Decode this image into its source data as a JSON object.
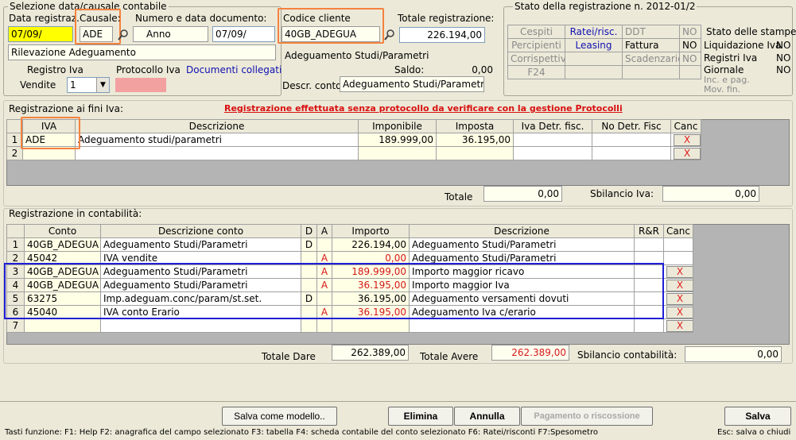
{
  "selection": {
    "legend": "Selezione data/causale contabile",
    "date_label": "Data registraz.",
    "date_value": "07/09/",
    "causale_label": "Causale:",
    "causale_value": "ADE",
    "num_label": "Numero e data documento:",
    "anno_value": "Anno",
    "doc_date_value": "07/09/",
    "codice_label": "Codice cliente",
    "codice_value": "40GB_ADEGUA",
    "totale_label": "Totale registrazione:",
    "totale_value": "226.194,00",
    "rilevazione_value": "Rilevazione Adeguamento",
    "cliente_name": "Adeguamento Studi/Parametri",
    "registro_label": "Registro Iva",
    "protocollo_label": "Protocollo Iva",
    "documenti_link": "Documenti collegati",
    "vendite_label": "Vendite",
    "vendite_value": "1",
    "saldo_label": "Saldo:",
    "saldo_value": "0,00",
    "descr_conto_label": "Descr. conto",
    "descr_conto_value": "Adeguamento Studi/Parametri"
  },
  "stato": {
    "legend": "Stato della registrazione n. 2012-01/2",
    "rows": [
      {
        "a": "Cespiti",
        "b": "Ratei/risc.",
        "c": "DDT",
        "d": "NO"
      },
      {
        "a": "Percipienti",
        "b": "Leasing",
        "c": "Fattura",
        "d": "NO"
      },
      {
        "a": "Corrispettivi",
        "b": "",
        "c": "Scadenzario",
        "d": "NO"
      },
      {
        "a": "F24",
        "b": "",
        "c": "",
        "d": ""
      }
    ],
    "stampe_title": "Stato delle stampe:",
    "stampe": [
      {
        "label": "Liquidazione Iva",
        "value": "NO"
      },
      {
        "label": "Registri Iva",
        "value": "NO"
      },
      {
        "label": "Giornale",
        "value": "NO"
      },
      {
        "label": "Inc. e pag.",
        "value": ""
      },
      {
        "label": "Mov. fin.",
        "value": ""
      }
    ]
  },
  "iva": {
    "title": "Registrazione ai fini Iva:",
    "warning": "Registrazione effettuata senza protocollo da verificare con la gestione Protocolli",
    "headers": [
      "IVA",
      "Descrizione",
      "Imponibile",
      "Imposta",
      "Iva Detr. fisc.",
      "No Detr. Fisc",
      "Canc"
    ],
    "rows": [
      {
        "n": "1",
        "iva": "ADE",
        "descr": "Adeguamento studi/parametri",
        "imponibile": "189.999,00",
        "imposta": "36.195,00",
        "detr": "",
        "nodetr": "",
        "canc": "X"
      },
      {
        "n": "2",
        "iva": "",
        "descr": "",
        "imponibile": "",
        "imposta": "",
        "detr": "",
        "nodetr": "",
        "canc": "X"
      }
    ],
    "totale_label": "Totale",
    "totale_value": "0,00",
    "sbilancio_label": "Sbilancio Iva:",
    "sbilancio_value": "0,00"
  },
  "contab": {
    "title": "Registrazione in contabilità:",
    "headers": [
      "Conto",
      "Descrizione conto",
      "D",
      "A",
      "Importo",
      "Descrizione",
      "R&R",
      "Canc"
    ],
    "rows": [
      {
        "n": "1",
        "conto": "40GB_ADEGUA",
        "descr_conto": "Adeguamento Studi/Parametri",
        "d": "D",
        "a": "",
        "importo": "226.194,00",
        "red": false,
        "descr": "Adeguamento Studi/Parametri",
        "canc": ""
      },
      {
        "n": "2",
        "conto": "45042",
        "descr_conto": "IVA vendite",
        "d": "",
        "a": "A",
        "importo": "0,00",
        "red": true,
        "descr": "Adeguamento Studi/Parametri",
        "canc": ""
      },
      {
        "n": "3",
        "conto": "40GB_ADEGUA",
        "descr_conto": "Adeguamento Studi/Parametri",
        "d": "",
        "a": "A",
        "importo": "189.999,00",
        "red": true,
        "descr": "Importo maggior ricavo",
        "canc": "X"
      },
      {
        "n": "4",
        "conto": "40GB_ADEGUA",
        "descr_conto": "Adeguamento Studi/Parametri",
        "d": "",
        "a": "A",
        "importo": "36.195,00",
        "red": true,
        "descr": "Importo maggior Iva",
        "canc": "X"
      },
      {
        "n": "5",
        "conto": "63275",
        "descr_conto": "Imp.adeguam.conc/param/st.set.",
        "d": "D",
        "a": "",
        "importo": "36.195,00",
        "red": false,
        "descr": "Adeguamento versamenti dovuti",
        "canc": "X"
      },
      {
        "n": "6",
        "conto": "45040",
        "descr_conto": "IVA conto Erario",
        "d": "",
        "a": "A",
        "importo": "36.195,00",
        "red": true,
        "descr": "Adeguamento Iva c/erario",
        "canc": "X"
      },
      {
        "n": "7",
        "conto": "",
        "descr_conto": "",
        "d": "",
        "a": "",
        "importo": "",
        "red": false,
        "descr": "",
        "canc": "X"
      }
    ],
    "totale_dare_label": "Totale Dare",
    "totale_dare_value": "262.389,00",
    "totale_avere_label": "Totale Avere",
    "totale_avere_value": "262.389,00",
    "sbilancio_label": "Sbilancio contabilità:",
    "sbilancio_value": "0,00"
  },
  "buttons": {
    "salva_modello": "Salva come modello..",
    "elimina": "Elimina",
    "annulla": "Annulla",
    "pagamento": "Pagamento o riscossione",
    "salva": "Salva"
  },
  "status_bar": {
    "left": "Tasti funzione: F1: Help F2: anagrafica del campo selezionato  F3: tabella   F4: scheda contabile del conto selezionato   F6: Ratei/risconti    F7:Spesometro",
    "right": "Esc: salva o chiudi"
  },
  "colors": {
    "highlight_orange": "#f4823f",
    "highlight_blue": "#1f1fd6",
    "date_yellow": "#ffff00",
    "protocol_pink": "#f2a0a0",
    "error_red": "#d61818"
  }
}
